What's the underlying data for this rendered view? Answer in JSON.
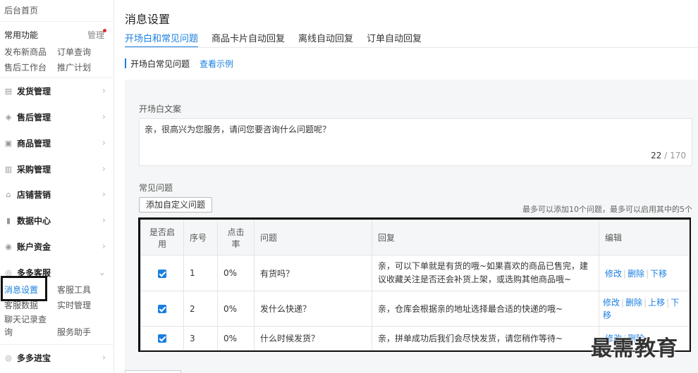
{
  "sidebar": {
    "home": "后台首页",
    "common_title": "常用功能",
    "manage": "管理",
    "quick_links": [
      "发布新商品",
      "订单查询",
      "售后工作台",
      "推广计划"
    ],
    "menus": [
      {
        "label": "发货管理",
        "icon": "doc-icon"
      },
      {
        "label": "售后管理",
        "icon": "shield-icon"
      },
      {
        "label": "商品管理",
        "icon": "box-icon"
      },
      {
        "label": "采购管理",
        "icon": "cart-icon"
      },
      {
        "label": "店铺营销",
        "icon": "store-icon"
      },
      {
        "label": "数据中心",
        "icon": "chart-icon"
      },
      {
        "label": "账户资金",
        "icon": "wallet-icon"
      },
      {
        "label": "多多客服",
        "icon": "headset-icon"
      },
      {
        "label": "多多进宝",
        "icon": "gift-icon"
      }
    ],
    "service_subs": [
      "消息设置",
      "客服工具",
      "客服数据",
      "实时管理",
      "聊天记录查询",
      "服务助手"
    ]
  },
  "main": {
    "title": "消息设置",
    "tabs": [
      "开场白和常见问题",
      "商品卡片自动回复",
      "离线自动回复",
      "订单自动回复"
    ],
    "section_title": "开场白常见问题",
    "section_link": "查看示例",
    "opening_label": "开场白文案",
    "opening_text": "亲，很高兴为您服务，请问您要咨询什么问题呢？",
    "counter_current": "22",
    "counter_sep": " / ",
    "counter_max": "170",
    "faq_label": "常见问题",
    "add_button": "添加自定义问题",
    "limit_hint": "最多可以添加10个问题，最多可以启用其中的5个",
    "table": {
      "headers": [
        "是否启用",
        "序号",
        "点击率",
        "问题",
        "回复",
        "编辑"
      ],
      "rows": [
        {
          "enabled": true,
          "no": "1",
          "rate": "0%",
          "question": "有货吗？",
          "reply": "亲，可以下单就是有货的哦~如果喜欢的商品已售完，建议收藏关注是否还会补货上架，或选购其他商品哦~",
          "actions": [
            "修改",
            "删除",
            "下移"
          ]
        },
        {
          "enabled": true,
          "no": "2",
          "rate": "0%",
          "question": "发什么快递？",
          "reply": "亲，仓库会根据亲的地址选择最合适的快递的哦~",
          "actions": [
            "修改",
            "删除",
            "上移",
            "下移"
          ]
        },
        {
          "enabled": true,
          "no": "3",
          "rate": "0%",
          "question": "什么时候发货？",
          "reply": "亲，拼单成功后我们会尽快发货，请您稍作等待~",
          "actions": [
            "修改",
            "删除"
          ]
        }
      ]
    }
  },
  "watermark": "最需教育",
  "colors": {
    "accent": "#1a7fe0",
    "badge": "#e02e24"
  }
}
